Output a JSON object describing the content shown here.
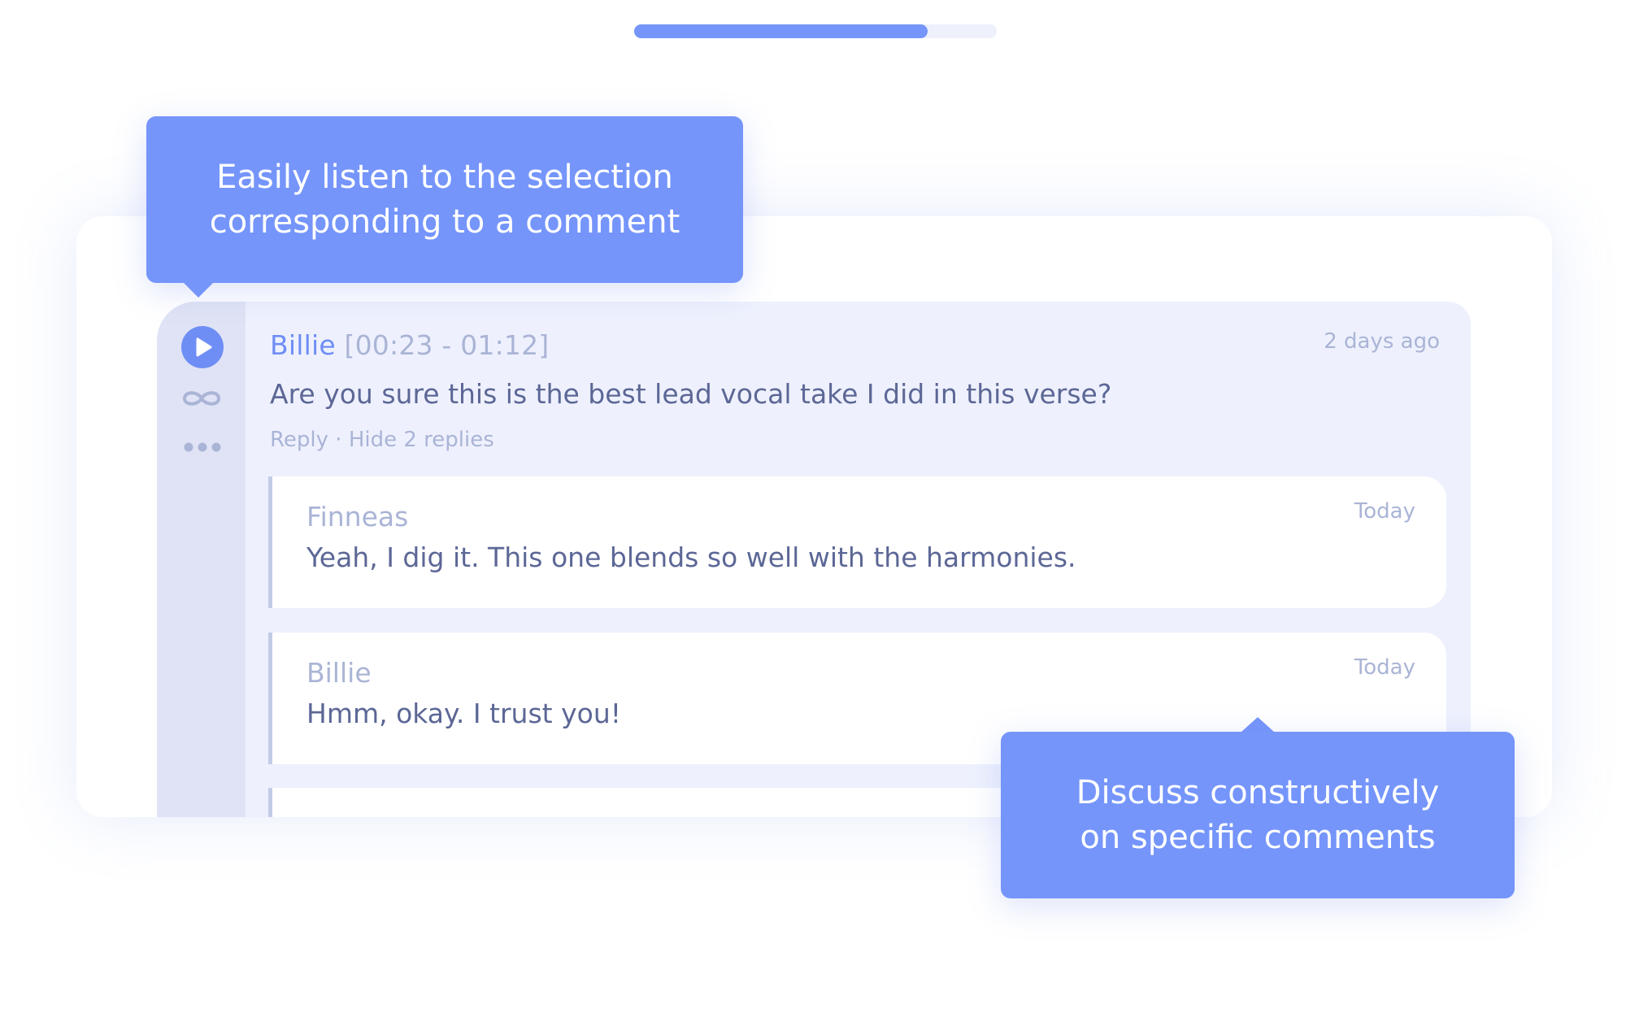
{
  "progress": {
    "value": 0.81
  },
  "callouts": {
    "listen": "Easily listen to the selection\ncorresponding to a comment",
    "discuss": "Discuss constructively\non specific comments"
  },
  "thread": {
    "rail": {
      "play_icon": "play-icon",
      "loop_icon": "infinity-icon",
      "more_icon": "more-dots-icon"
    },
    "comment": {
      "author": "Billie",
      "range": "[00:23 - 01:12]",
      "time": "2 days ago",
      "text": "Are you sure this is the best lead vocal take I did in this verse?",
      "reply_action": "Reply",
      "separator": "·",
      "hide_action": "Hide 2 replies"
    },
    "replies": [
      {
        "author": "Finneas",
        "time": "Today",
        "text": "Yeah, I dig it. This one blends so well with the harmonies."
      },
      {
        "author": "Billie",
        "time": "Today",
        "text": "Hmm, okay. I trust you!"
      }
    ]
  },
  "colors": {
    "accent": "#7595fb",
    "thread_bg": "#eef1fd",
    "rail_bg": "#dfe3f5",
    "muted_text": "#aab4d6",
    "body_text": "#5c6796"
  }
}
